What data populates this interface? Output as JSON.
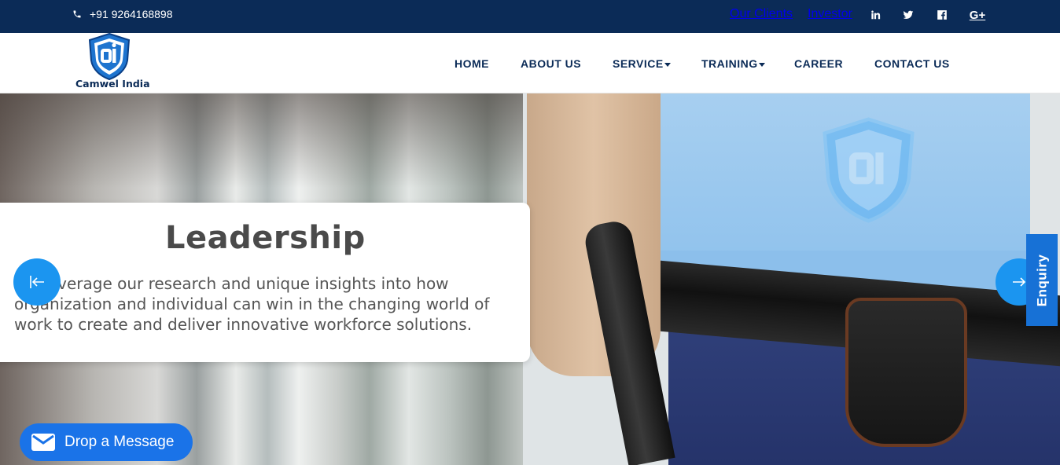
{
  "topbar": {
    "phone": "+91 9264168898",
    "links": {
      "clients": "Our Clients",
      "investor": "Investor"
    },
    "social": [
      "linkedin-icon",
      "twitter-icon",
      "facebook-icon",
      "google-plus-icon"
    ]
  },
  "header": {
    "brand": "Camwel India",
    "nav": {
      "home": "HOME",
      "about": "ABOUT US",
      "service": "SERVICE",
      "training": "TRAINING",
      "career": "CAREER",
      "contact": "CONTACT US"
    }
  },
  "hero": {
    "title": "Leadership",
    "body": "We leverage our research and unique insights into how organization and individual can win in the changing world of work to create and deliver innovative workforce solutions."
  },
  "enquiry": "Enquiry",
  "drop_message": "Drop a Message",
  "colors": {
    "navy": "#0b2b57",
    "accent": "#1b95f0",
    "enquiry": "#1771d6",
    "drop": "#1a73e8"
  }
}
